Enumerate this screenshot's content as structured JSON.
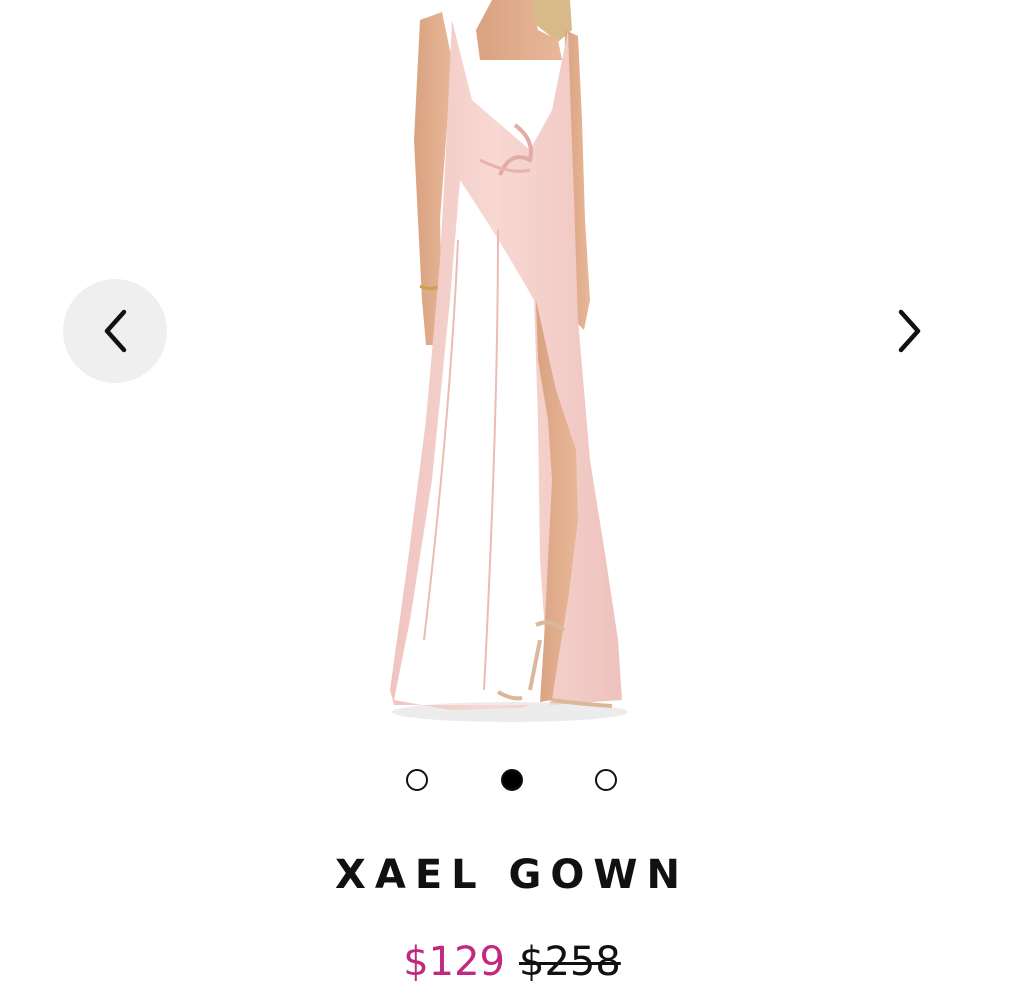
{
  "carousel": {
    "image_alt": "Pink satin gown with twist front and thigh-high slit",
    "prev_icon": "chevron-left-icon",
    "next_icon": "chevron-right-icon",
    "slide_count": 3,
    "active_slide": 2
  },
  "product": {
    "title": "XAEL GOWN",
    "sale_price": "$129",
    "original_price": "$258"
  },
  "colors": {
    "sale_price": "#c2287e",
    "dress": "#f6d0cb",
    "nav_button_bg": "#efefef"
  }
}
